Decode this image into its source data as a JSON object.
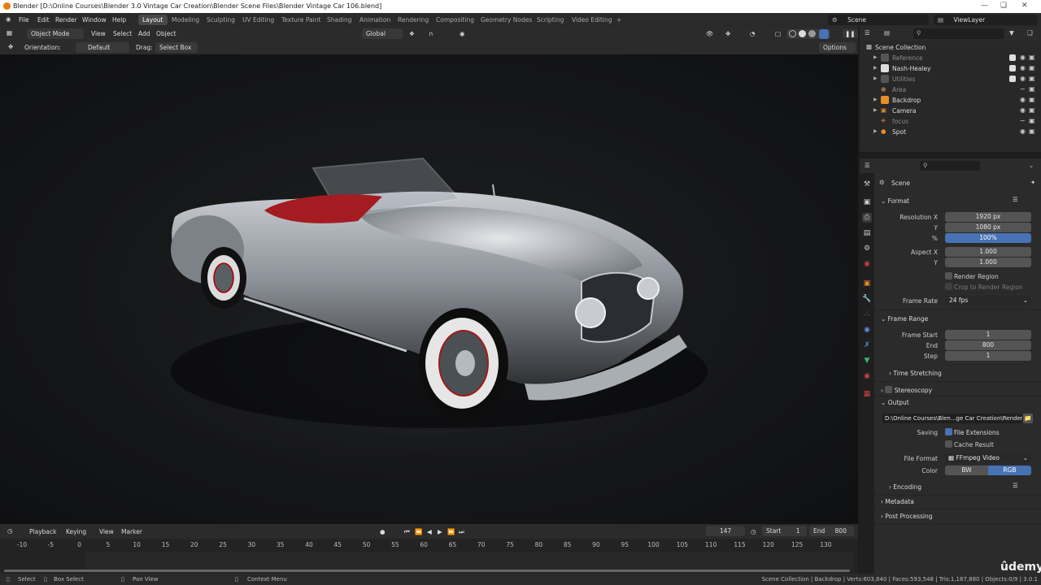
{
  "window": {
    "title": "Blender [D:\\Online Courses\\Blender 3.0 Vintage Car Creation\\Blender Scene Files\\Blender Vintage Car 106.blend]"
  },
  "menu": [
    "File",
    "Edit",
    "Render",
    "Window",
    "Help"
  ],
  "workspaces": [
    "Layout",
    "Modeling",
    "Sculpting",
    "UV Editing",
    "Texture Paint",
    "Shading",
    "Animation",
    "Rendering",
    "Compositing",
    "Geometry Nodes",
    "Scripting",
    "Video Editing"
  ],
  "active_workspace": "Layout",
  "scene": {
    "name": "Scene",
    "view_layer": "ViewLayer"
  },
  "header3d": {
    "mode": "Object Mode",
    "view": "View",
    "select": "Select",
    "add": "Add",
    "object": "Object",
    "transform": "Global"
  },
  "toolheader": {
    "orientation_label": "Orientation:",
    "orientation": "Default",
    "drag_label": "Drag:",
    "drag": "Select Box",
    "options": "Options"
  },
  "outliner": {
    "title": "Scene Collection",
    "items": [
      {
        "name": "Reference",
        "dim": true
      },
      {
        "name": "Nash-Healey",
        "dim": false
      },
      {
        "name": "Utilities",
        "dim": true
      },
      {
        "name": "Area",
        "dim": true
      },
      {
        "name": "Backdrop",
        "dim": false
      },
      {
        "name": "Camera",
        "dim": false
      },
      {
        "name": "focus",
        "dim": true
      },
      {
        "name": "Spot",
        "dim": false
      }
    ]
  },
  "properties": {
    "context": "Scene",
    "format": {
      "title": "Format",
      "res_x_label": "Resolution X",
      "res_x": "1920 px",
      "res_y_label": "Y",
      "res_y": "1080 px",
      "pct_label": "%",
      "pct": "100%",
      "aspect_x_label": "Aspect X",
      "aspect_x": "1.000",
      "aspect_y_label": "Y",
      "aspect_y": "1.000",
      "render_region": "Render Region",
      "crop_region": "Crop to Render Region",
      "frame_rate_label": "Frame Rate",
      "frame_rate": "24 fps"
    },
    "frame_range": {
      "title": "Frame Range",
      "start_label": "Frame Start",
      "start": "1",
      "end_label": "End",
      "end": "800",
      "step_label": "Step",
      "step": "1"
    },
    "time_stretching": "Time Stretching",
    "stereoscopy": "Stereoscopy",
    "output": {
      "title": "Output",
      "path": "D:\\Online Courses\\Blen...ge Car Creation\\Renders\\",
      "saving_label": "Saving",
      "file_ext": "File Extensions",
      "cache_result": "Cache Result",
      "file_format_label": "File Format",
      "file_format": "FFmpeg Video",
      "color_label": "Color",
      "bw": "BW",
      "rgb": "RGB"
    },
    "encoding": "Encoding",
    "metadata": "Metadata",
    "post_processing": "Post Processing"
  },
  "timeline": {
    "playback": "Playback",
    "keying": "Keying",
    "view": "View",
    "marker": "Marker",
    "current_frame": "147",
    "start_label": "Start",
    "start": "1",
    "end_label": "End",
    "end": "800",
    "ruler": [
      "-10",
      "-5",
      "0",
      "5",
      "10",
      "15",
      "20",
      "25",
      "30",
      "35",
      "40",
      "45",
      "50",
      "55",
      "60",
      "65",
      "70",
      "75",
      "80",
      "85",
      "90",
      "95",
      "100",
      "105",
      "110",
      "115",
      "120",
      "125",
      "130"
    ]
  },
  "status": {
    "select": "Select",
    "box_select": "Box Select",
    "pan_view": "Pan View",
    "context_menu": "Context Menu",
    "stats": "Scene Collection | Backdrop | Verts:603,840 | Faces:593,548 | Tris:1,187,880 | Objects:0/9 | 3.0.1"
  },
  "watermark": "ûdemy"
}
